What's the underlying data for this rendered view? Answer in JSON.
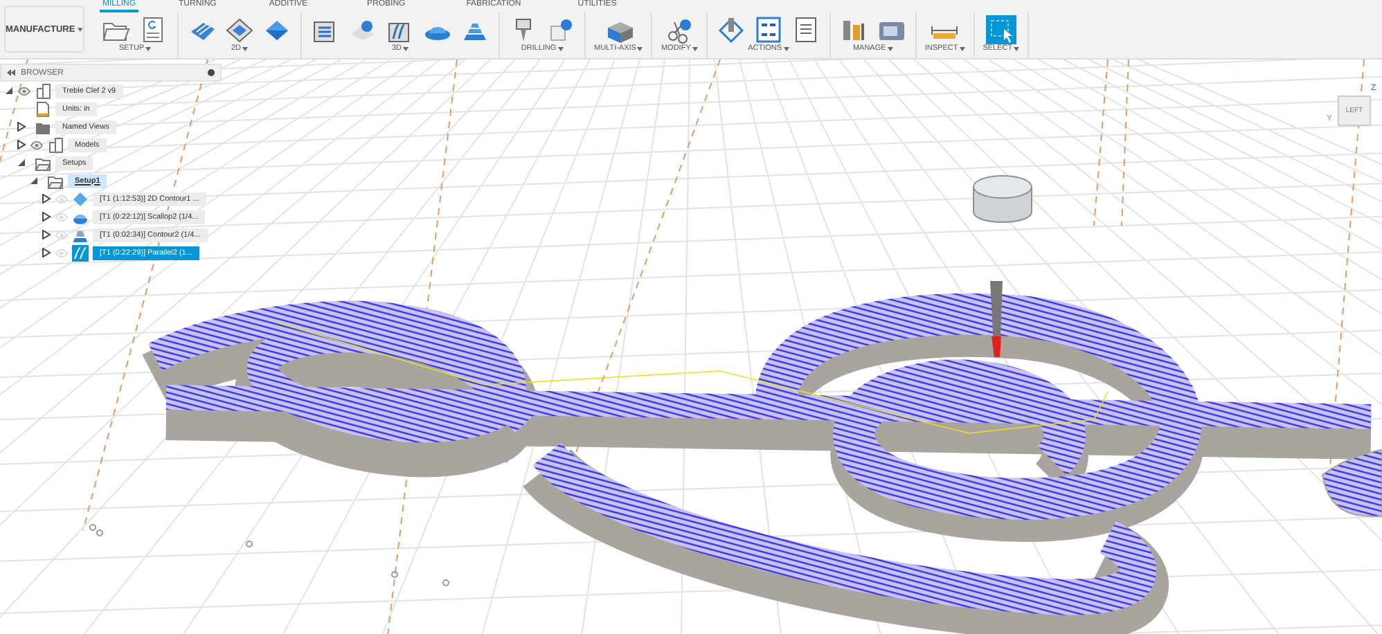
{
  "workspace": {
    "label": "MANUFACTURE"
  },
  "tabs": [
    {
      "label": "MILLING",
      "selected": true
    },
    {
      "label": "TURNING",
      "selected": false
    },
    {
      "label": "ADDITIVE",
      "selected": false
    },
    {
      "label": "PROBING",
      "selected": false
    },
    {
      "label": "FABRICATION",
      "selected": false
    },
    {
      "label": "UTILITIES",
      "selected": false
    }
  ],
  "groups": [
    {
      "label": "SETUP",
      "tools": [
        {
          "kind": "folder"
        },
        {
          "kind": "sheet"
        }
      ]
    },
    {
      "label": "2D",
      "tools": [
        {
          "kind": "stack"
        },
        {
          "kind": "diamond"
        },
        {
          "kind": "layers"
        }
      ]
    },
    {
      "label": "3D",
      "tools": [
        {
          "kind": "plate"
        },
        {
          "kind": "wrench"
        },
        {
          "kind": "ribbon"
        },
        {
          "kind": "dome"
        },
        {
          "kind": "steps"
        }
      ]
    },
    {
      "label": "DRILLING",
      "tools": [
        {
          "kind": "drill"
        },
        {
          "kind": "drillwrench"
        }
      ]
    },
    {
      "label": "MULTI-AXIS",
      "tools": [
        {
          "kind": "block"
        }
      ]
    },
    {
      "label": "MODIFY",
      "tools": [
        {
          "kind": "scissors"
        }
      ]
    },
    {
      "label": "ACTIONS",
      "tools": [
        {
          "kind": "probe"
        },
        {
          "kind": "gcode"
        },
        {
          "kind": "list"
        }
      ]
    },
    {
      "label": "MANAGE",
      "tools": [
        {
          "kind": "tools"
        },
        {
          "kind": "machine"
        }
      ]
    },
    {
      "label": "INSPECT",
      "tools": [
        {
          "kind": "ruler"
        }
      ]
    },
    {
      "label": "SELECT",
      "tools": [
        {
          "kind": "selection"
        }
      ]
    }
  ],
  "browser": {
    "title": "BROWSER",
    "tree": [
      {
        "label": "Treble Clef 2 v9",
        "kind": "component",
        "expanded": true,
        "visible": true,
        "selected": false,
        "active": false,
        "children": [
          {
            "label": "Units: in",
            "kind": "units",
            "selected": false,
            "active": false
          },
          {
            "label": "Named Views",
            "kind": "folder",
            "expanded": false,
            "selected": false,
            "active": false
          },
          {
            "label": "Models",
            "kind": "component",
            "expanded": false,
            "visible": true,
            "selected": false,
            "active": false
          },
          {
            "label": "Setups",
            "kind": "setup",
            "expanded": true,
            "selected": false,
            "active": false,
            "children": [
              {
                "label": "Setup1",
                "kind": "setup",
                "expanded": true,
                "selected": false,
                "active": true,
                "children": [
                  {
                    "label": "[T1 (1:12:53)] 2D Contour1 ...",
                    "kind": "contour2d",
                    "expanded": false,
                    "visible": false,
                    "selected": false,
                    "active": false
                  },
                  {
                    "label": "[T1 (0:22:12)] Scallop2 (1/4...",
                    "kind": "scallop",
                    "expanded": false,
                    "visible": false,
                    "selected": false,
                    "active": false
                  },
                  {
                    "label": "[T1 (0:02:34)] Contour2 (1/4...",
                    "kind": "contour",
                    "expanded": false,
                    "visible": false,
                    "selected": false,
                    "active": false
                  },
                  {
                    "label": "[T1 (0:22:29)] Parallel2 (1...",
                    "kind": "parallel",
                    "expanded": false,
                    "visible": false,
                    "selected": true,
                    "active": false
                  }
                ]
              }
            ]
          }
        ]
      }
    ]
  },
  "viewcube": {
    "face": "LEFT",
    "axes": [
      "Y",
      "Z"
    ]
  }
}
